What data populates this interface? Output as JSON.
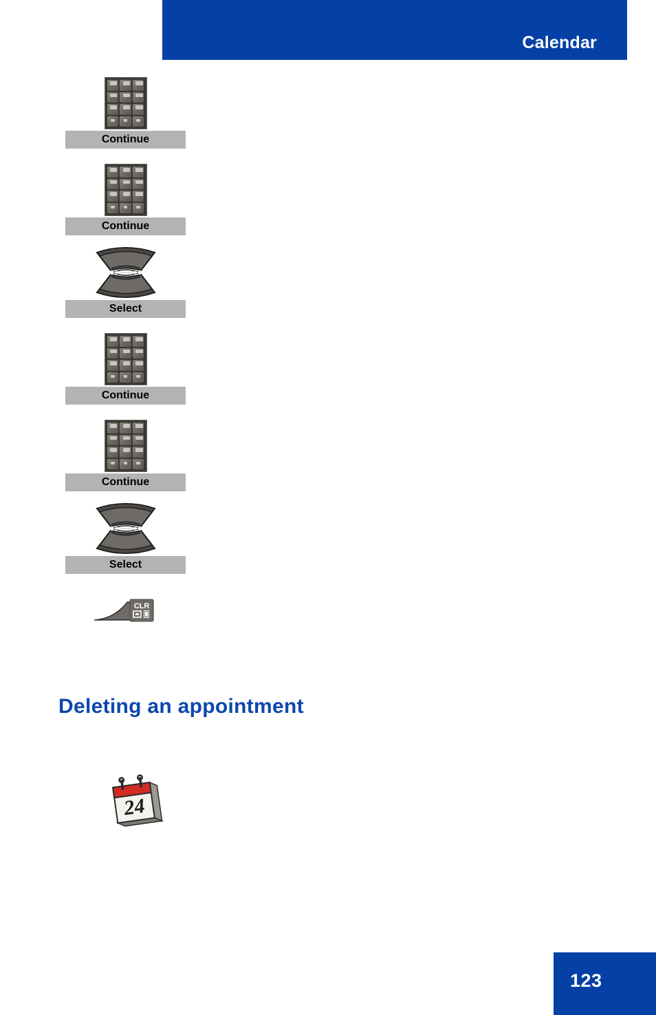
{
  "header": {
    "title": "Calendar",
    "bar_color": "#0540a6",
    "title_color": "#ffffff"
  },
  "steps": [
    {
      "icon": "keypad-icon",
      "label": "Continue"
    },
    {
      "icon": "keypad-icon",
      "label": "Continue"
    },
    {
      "icon": "navigation-key-icon",
      "label": "Select"
    },
    {
      "icon": "keypad-icon",
      "label": "Continue"
    },
    {
      "icon": "keypad-icon",
      "label": "Continue"
    },
    {
      "icon": "navigation-key-icon",
      "label": "Select"
    },
    {
      "icon": "clr-key-icon",
      "label": ""
    }
  ],
  "clr_key": {
    "label": "CLR"
  },
  "section": {
    "heading": "Deleting an appointment",
    "heading_color": "#0d47ac"
  },
  "calendar_icon": {
    "name": "calendar-24-icon",
    "day": "24",
    "header_color": "#d32a23",
    "body_color": "#f5f3ef"
  },
  "footer": {
    "page_number": "123",
    "box_color": "#0540a6",
    "text_color": "#ffffff"
  },
  "label_style": {
    "background": "#b3b3b3",
    "text_color": "#000000"
  }
}
